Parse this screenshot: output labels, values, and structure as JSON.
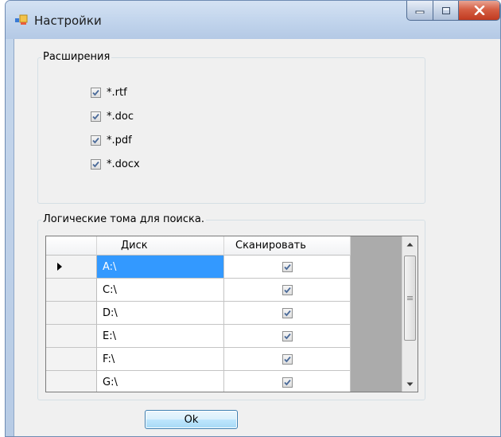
{
  "window": {
    "title": "Настройки"
  },
  "extensions": {
    "legend": "Расширения",
    "items": [
      {
        "label": "*.rtf",
        "checked": true
      },
      {
        "label": "*.doc",
        "checked": true
      },
      {
        "label": "*.pdf",
        "checked": true
      },
      {
        "label": "*.docx",
        "checked": true
      }
    ]
  },
  "volumes": {
    "legend": "Логические тома для поиска.",
    "columns": {
      "disk": "Диск",
      "scan": "Сканировать"
    },
    "rows": [
      {
        "disk": "A:\\",
        "scan": true,
        "selected": true
      },
      {
        "disk": "C:\\",
        "scan": true
      },
      {
        "disk": "D:\\",
        "scan": true
      },
      {
        "disk": "E:\\",
        "scan": true
      },
      {
        "disk": "F:\\",
        "scan": true
      },
      {
        "disk": "G:\\",
        "scan": true
      }
    ]
  },
  "buttons": {
    "ok": "Ok"
  },
  "colors": {
    "selection": "#3399ff",
    "close": "#c13a20"
  }
}
